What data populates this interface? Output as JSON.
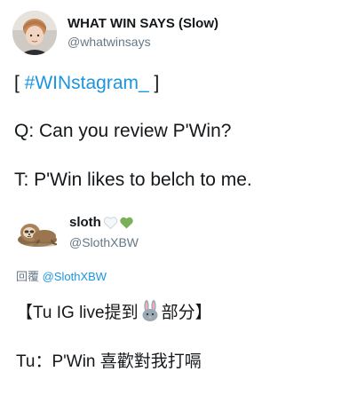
{
  "tweet": {
    "display_name": "WHAT WIN SAYS (Slow)",
    "handle": "@whatwinsays",
    "avatar_icon": "profile-photo",
    "line1_open": "[ ",
    "hashtag": "#WINstagram_",
    "line1_close": " ]",
    "line2": "Q: Can you review P'Win?",
    "line3": "T: P'Win likes to belch to me."
  },
  "quoted": {
    "display_name": "sloth",
    "name_emojis": [
      "white-heart-icon",
      "green-heart-icon"
    ],
    "handle": "@SlothXBW",
    "avatar_icon": "sloth-icon",
    "reply_label": "回覆",
    "reply_handle": "@SlothXBW",
    "line1_before": "【Tu IG live提到",
    "line1_emoji": "rabbit-face-icon",
    "line1_after": "部分】",
    "line2": "Tu：P'Win 喜歡對我打嗝"
  },
  "colors": {
    "text": "#14171a",
    "secondary": "#657786",
    "link": "#1b95e0",
    "green_heart": "#78b159"
  }
}
